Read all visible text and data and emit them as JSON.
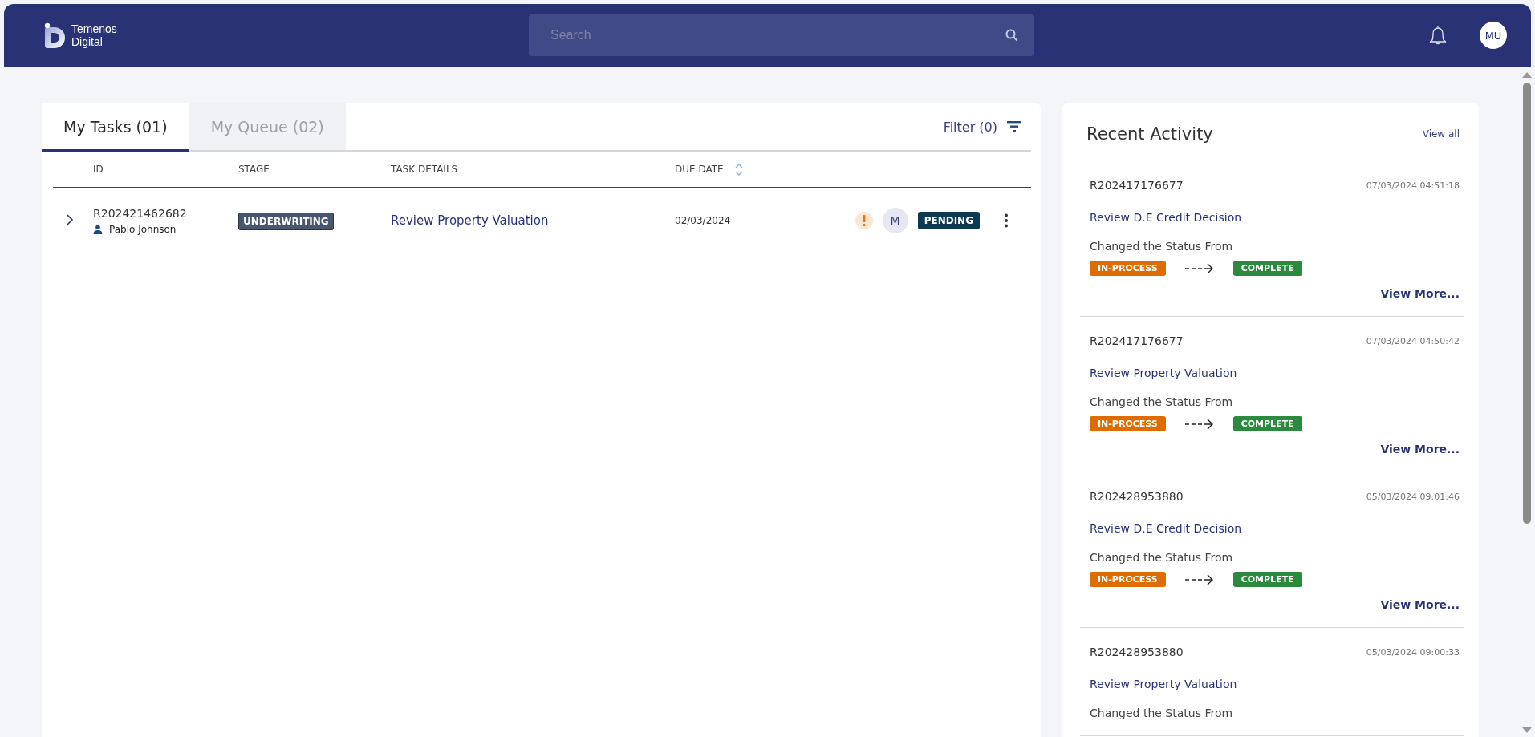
{
  "header": {
    "logo": {
      "line1": "Temenos",
      "line2": "Digital"
    },
    "search": {
      "placeholder": "Search"
    },
    "avatar": "MU"
  },
  "tasks": {
    "tabs": [
      {
        "label": "My Tasks (01)",
        "selected": true
      },
      {
        "label": "My Queue (02)",
        "selected": false
      }
    ],
    "filter": "Filter (0)",
    "columns": [
      "ID",
      "STAGE",
      "TASK DETAILS",
      "DUE DATE"
    ],
    "rows": [
      {
        "id": "R202421462682",
        "assignee": "Pablo Johnson",
        "stage": "UNDERWRITING",
        "details": "Review Property Valuation",
        "due": "02/03/2024",
        "flagged": true,
        "initial": "M",
        "status": "PENDING",
        "expanded": false
      }
    ]
  },
  "activity": {
    "title": "Recent Activity",
    "view_all": "View all",
    "items": [
      {
        "id": "R202417176677",
        "time": "07/03/2024 04:51:18",
        "task": "Review D.E Credit Decision",
        "text": "Changed the Status From",
        "from": "IN-PROCESS",
        "to": "COMPLETE",
        "more": "View More..."
      },
      {
        "id": "R202417176677",
        "time": "07/03/2024 04:50:42",
        "task": "Review Property Valuation",
        "text": "Changed the Status From",
        "from": "IN-PROCESS",
        "to": "COMPLETE",
        "more": "View More..."
      },
      {
        "id": "R202428953880",
        "time": "05/03/2024 09:01:46",
        "task": "Review D.E Credit Decision",
        "text": "Changed the Status From",
        "from": "IN-PROCESS",
        "to": "COMPLETE",
        "more": "View More..."
      },
      {
        "id": "R202428953880",
        "time": "05/03/2024 09:00:33",
        "task": "Review Property Valuation",
        "text": "Changed the Status From"
      }
    ]
  }
}
